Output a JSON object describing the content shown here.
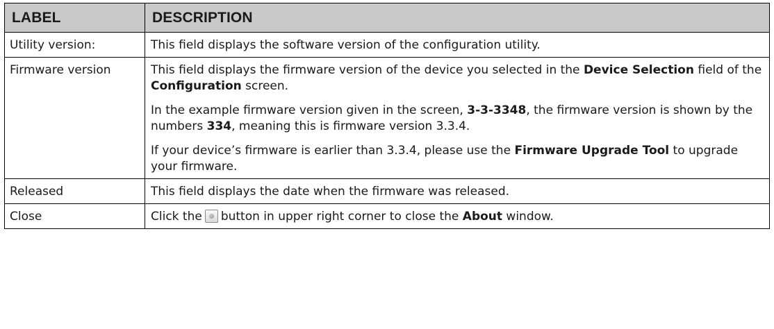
{
  "table": {
    "headers": {
      "label": "LABEL",
      "description": "DESCRIPTION"
    },
    "rows": [
      {
        "label": "Utility version:",
        "text": "This field displays the software version of the configuration utility."
      },
      {
        "label": "Firmware version",
        "p1_a": "This field displays the firmware version of the device you selected in the",
        "p1_b1": "Device Selection",
        "p1_c": "field of the",
        "p1_b2": "Configuration",
        "p1_d": "screen.",
        "p2_a": "In the example firmware version given in the screen,",
        "p2_b1": "3-3-3348",
        "p2_c": ", the firmware version is shown by the numbers",
        "p2_b2": "334",
        "p2_d": ", meaning this is firmware version 3.3.4.",
        "p3_a": "If your device’s firmware is earlier than 3.3.4, please use the",
        "p3_b": "Firmware Upgrade Tool",
        "p3_c": "to upgrade your firmware."
      },
      {
        "label": "Released",
        "text": "This field displays the date when the firmware was released."
      },
      {
        "label": "Close",
        "text_a": "Click the",
        "text_b": "button in upper right corner to close the",
        "text_bold": "About",
        "text_c": "window.",
        "icon": "close-circle-icon"
      }
    ]
  }
}
